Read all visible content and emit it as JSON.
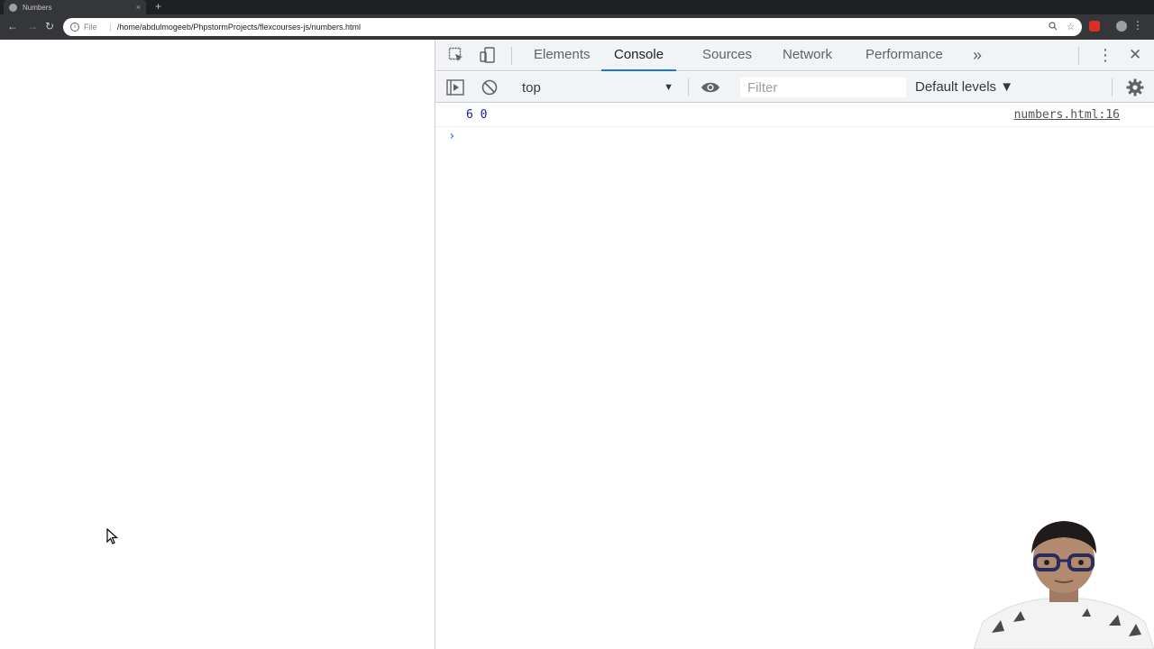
{
  "browser": {
    "tab_title": "Numbers",
    "tab_close": "×",
    "new_tab": "+",
    "url_scheme": "File",
    "url_separator": "|",
    "url": "/home/abdulmogeeb/PhpstormProjects/flexcourses-js/numbers.html",
    "nav": {
      "back": "←",
      "forward": "→",
      "reload": "↻"
    },
    "menu": "⋮",
    "colors": {
      "tabstrip": "#1f2023",
      "toolbar": "#35363a",
      "omnibox": "#ffffff"
    }
  },
  "devtools": {
    "tabs": [
      {
        "label": "Elements",
        "active": false
      },
      {
        "label": "Console",
        "active": true
      },
      {
        "label": "Sources",
        "active": false
      },
      {
        "label": "Network",
        "active": false
      },
      {
        "label": "Performance",
        "active": false
      }
    ],
    "overflow": "»",
    "kebab": "⋮",
    "close": "✕",
    "context": "top",
    "context_arrow": "▼",
    "filter_placeholder": "Filter",
    "levels_label": "Default levels ▼",
    "accent": "#1a73e8"
  },
  "console": {
    "messages": [
      {
        "value": "6 0",
        "source": "numbers.html:16"
      }
    ],
    "prompt": "›"
  }
}
